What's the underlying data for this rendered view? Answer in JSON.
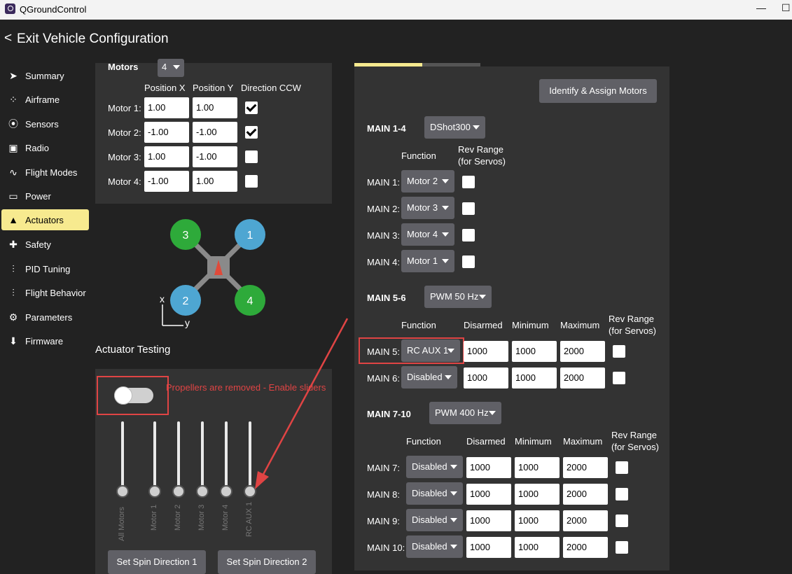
{
  "window": {
    "title": "QGroundControl",
    "minimize": "—",
    "maximize": "☐"
  },
  "header": {
    "back_glyph": "<",
    "title": "Exit Vehicle Configuration"
  },
  "sidebar": {
    "items": [
      {
        "label": "Summary",
        "icon": "paper-plane-icon"
      },
      {
        "label": "Airframe",
        "icon": "airframe-icon"
      },
      {
        "label": "Sensors",
        "icon": "sensors-icon"
      },
      {
        "label": "Radio",
        "icon": "radio-icon"
      },
      {
        "label": "Flight Modes",
        "icon": "flight-modes-icon"
      },
      {
        "label": "Power",
        "icon": "power-icon"
      },
      {
        "label": "Actuators",
        "icon": "actuators-icon"
      },
      {
        "label": "Safety",
        "icon": "safety-icon"
      },
      {
        "label": "PID Tuning",
        "icon": "pid-tuning-icon"
      },
      {
        "label": "Flight Behavior",
        "icon": "flight-behavior-icon"
      },
      {
        "label": "Parameters",
        "icon": "parameters-icon"
      },
      {
        "label": "Firmware",
        "icon": "firmware-icon"
      }
    ],
    "active": "Actuators"
  },
  "geometry": {
    "motors_label": "Motors",
    "motors_count": "4",
    "headers": {
      "x": "Position X",
      "y": "Position Y",
      "ccw": "Direction CCW"
    },
    "motors": [
      {
        "label": "Motor 1:",
        "x": "1.00",
        "y": "1.00",
        "ccw": true
      },
      {
        "label": "Motor 2:",
        "x": "-1.00",
        "y": "-1.00",
        "ccw": true
      },
      {
        "label": "Motor 3:",
        "x": "1.00",
        "y": "-1.00",
        "ccw": false
      },
      {
        "label": "Motor 4:",
        "x": "-1.00",
        "y": "1.00",
        "ccw": false
      }
    ]
  },
  "diagram": {
    "motor_numbers": [
      "3",
      "1",
      "2",
      "4"
    ],
    "axis_x": "x",
    "axis_y": "y",
    "colors": {
      "cw": "#2eaa3a",
      "ccw": "#4ea6d2",
      "frame": "#8a8a8a",
      "arrow": "#e04a3a"
    }
  },
  "testing": {
    "title": "Actuator Testing",
    "enable_text": "Propellers are removed - Enable sliders",
    "sliders": [
      "All Motors",
      "Motor 1",
      "Motor 2",
      "Motor 3",
      "Motor 4",
      "RC AUX 1"
    ],
    "buttons": [
      "Set Spin Direction 1",
      "Set Spin Direction 2"
    ]
  },
  "outputs": {
    "identify_button": "Identify & Assign Motors",
    "col_function": "Function",
    "col_rev": "Rev Range",
    "col_rev2": "(for Servos)",
    "col_disarmed": "Disarmed",
    "col_min": "Minimum",
    "col_max": "Maximum",
    "groups": [
      {
        "name": "MAIN 1-4",
        "protocol": "DShot300",
        "rows": [
          {
            "label": "MAIN 1:",
            "function": "Motor 2"
          },
          {
            "label": "MAIN 2:",
            "function": "Motor 3"
          },
          {
            "label": "MAIN 3:",
            "function": "Motor 4"
          },
          {
            "label": "MAIN 4:",
            "function": "Motor 1"
          }
        ]
      },
      {
        "name": "MAIN 5-6",
        "protocol": "PWM 50 Hz",
        "rows": [
          {
            "label": "MAIN 5:",
            "function": "RC AUX 1",
            "disarmed": "1000",
            "min": "1000",
            "max": "2000"
          },
          {
            "label": "MAIN 6:",
            "function": "Disabled",
            "disarmed": "1000",
            "min": "1000",
            "max": "2000"
          }
        ]
      },
      {
        "name": "MAIN 7-10",
        "protocol": "PWM 400 Hz",
        "rows": [
          {
            "label": "MAIN 7:",
            "function": "Disabled",
            "disarmed": "1000",
            "min": "1000",
            "max": "2000"
          },
          {
            "label": "MAIN 8:",
            "function": "Disabled",
            "disarmed": "1000",
            "min": "1000",
            "max": "2000"
          },
          {
            "label": "MAIN 9:",
            "function": "Disabled",
            "disarmed": "1000",
            "min": "1000",
            "max": "2000"
          },
          {
            "label": "MAIN 10:",
            "function": "Disabled",
            "disarmed": "1000",
            "min": "1000",
            "max": "2000"
          }
        ]
      }
    ]
  },
  "colors": {
    "accent": "#f7ea8f",
    "annotation_red": "#e04444",
    "panel": "#333333",
    "background": "#222222"
  }
}
